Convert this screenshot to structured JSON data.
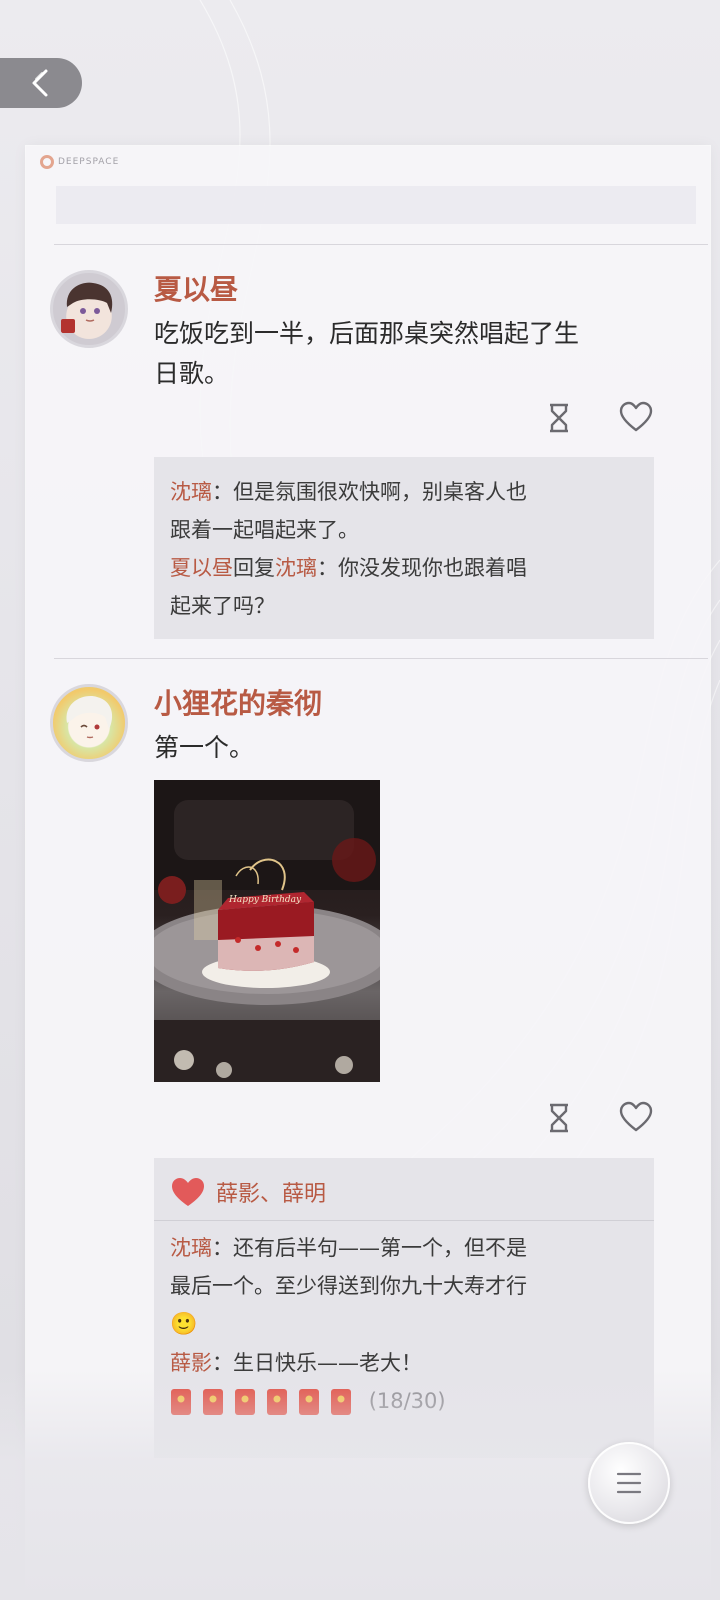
{
  "brand": {
    "logo_text": "DEEPSPACE"
  },
  "posts": [
    {
      "author": "夏以昼",
      "text_line1": "吃饭吃到一半，后面那桌突然唱起了生",
      "text_line2": "日歌。",
      "replies": [
        {
          "name": "沈璃",
          "sep": "：",
          "line1": "但是氛围很欢快啊，别桌客人也",
          "line2": "跟着一起唱起来了。"
        },
        {
          "name": "夏以昼",
          "mid": "回复",
          "target": "沈璃",
          "sep": "：",
          "line1": "你没发现你也跟着唱",
          "line2": "起来了吗？"
        }
      ]
    },
    {
      "author": "小狸花的秦彻",
      "text": "第一个。",
      "image": {
        "cake_text": "Happy Birthday"
      },
      "likes": "薛影、薛明",
      "replies": [
        {
          "name": "沈璃",
          "sep": "：",
          "line1": "还有后半句——第一个，但不是",
          "line2": "最后一个。至少得送到你九十大寿才行",
          "emoji": "🙂"
        },
        {
          "name": "薛影",
          "sep": "：",
          "line1": "生日快乐——老大！",
          "count": "(18/30)"
        }
      ]
    }
  ],
  "icons": [
    "back-arrow-icon",
    "hourglass-icon",
    "heart-outline-icon",
    "heart-filled-icon",
    "menu-icon",
    "red-envelope-icon"
  ],
  "colors": {
    "accent": "#b85a44",
    "heart": "#e25a5a",
    "card": "#f6f5f8"
  }
}
